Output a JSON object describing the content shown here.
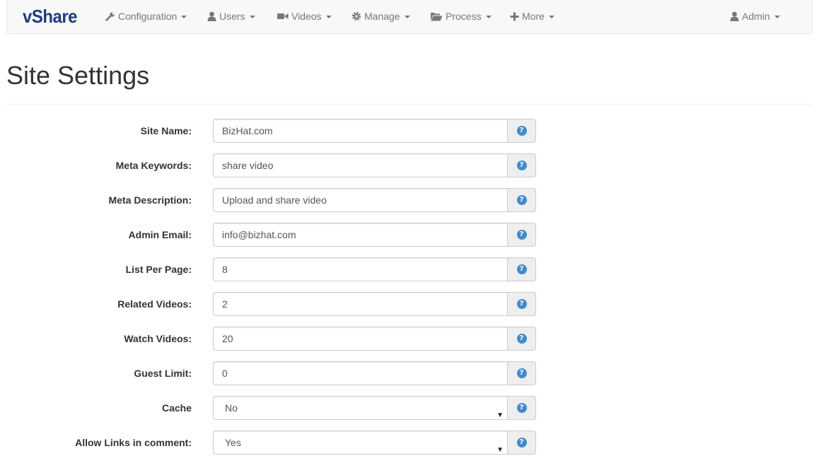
{
  "nav": {
    "brand": "vShare",
    "items": [
      {
        "label": "Configuration",
        "icon": "wrench-icon"
      },
      {
        "label": "Users",
        "icon": "user-icon"
      },
      {
        "label": "Videos",
        "icon": "video-camera-icon"
      },
      {
        "label": "Manage",
        "icon": "cog-icon"
      },
      {
        "label": "Process",
        "icon": "folder-open-icon"
      },
      {
        "label": "More",
        "icon": "plus-icon"
      }
    ],
    "user": {
      "label": "Admin",
      "icon": "user-icon"
    }
  },
  "page": {
    "title": "Site Settings"
  },
  "form": {
    "fields": [
      {
        "label": "Site Name:",
        "value": "BizHat.com"
      },
      {
        "label": "Meta Keywords:",
        "value": "share video"
      },
      {
        "label": "Meta Description:",
        "value": "Upload and share video"
      },
      {
        "label": "Admin Email:",
        "value": "info@bizhat.com"
      },
      {
        "label": "List Per Page:",
        "value": "8"
      },
      {
        "label": "Related Videos:",
        "value": "2"
      },
      {
        "label": "Watch Videos:",
        "value": "20"
      },
      {
        "label": "Guest Limit:",
        "value": "0"
      },
      {
        "label": "Cache",
        "value": "No"
      },
      {
        "label": "Allow Links in comment:",
        "value": "Yes"
      }
    ],
    "help_glyph": "?",
    "select_arrow": "▼"
  },
  "colors": {
    "brand": "#1f3d7a",
    "navbar_bg": "#f8f8f8",
    "nav_text": "#777777",
    "help_icon": "#428bca",
    "addon_bg": "#eeeeee"
  }
}
